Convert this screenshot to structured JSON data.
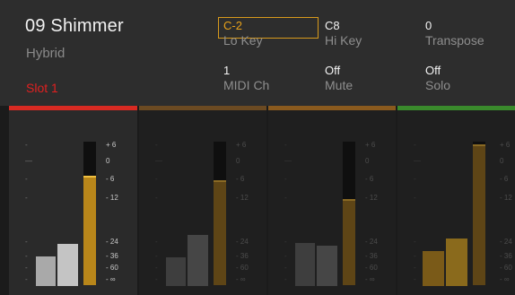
{
  "header": {
    "preset_name": "09 Shimmer",
    "preset_type": "Hybrid",
    "slot": "Slot 1",
    "params": [
      {
        "value": "C-2",
        "label": "Lo Key",
        "selected": true
      },
      {
        "value": "C8",
        "label": "Hi Key",
        "selected": false
      },
      {
        "value": "0",
        "label": "Transpose",
        "selected": false
      },
      {
        "value": "1",
        "label": "MIDI Ch",
        "selected": false
      },
      {
        "value": "Off",
        "label": "Mute",
        "selected": false
      },
      {
        "value": "Off",
        "label": "Solo",
        "selected": false
      }
    ]
  },
  "colors": {
    "header_bg": "#2d2d2d",
    "accent_orange": "#d89a1c",
    "slot_red": "#e02020",
    "strip1_bar": "#d82a22",
    "strip2_bar": "#6b4a22",
    "strip3_bar": "#8a5a1e",
    "strip4_bar": "#3a8a2c"
  },
  "meter_scale": {
    "left_marks": [
      "-",
      "—",
      "-",
      "-",
      "-",
      "-",
      "-",
      "-"
    ],
    "right_labels": [
      "+ 6",
      "0",
      "- 6",
      "- 12",
      "- 24",
      "- 36",
      "- 60",
      "- ∞"
    ]
  },
  "strips": [
    {
      "name": "slot-1",
      "active": true,
      "level": 0.76,
      "mini_levels": [
        0.3,
        0.43
      ]
    },
    {
      "name": "slot-2",
      "active": false,
      "level": 0.73,
      "mini_levels": [
        0.29,
        0.52
      ]
    },
    {
      "name": "slot-3",
      "active": false,
      "level": 0.6,
      "mini_levels": [
        0.44,
        0.41
      ]
    },
    {
      "name": "slot-4",
      "active": false,
      "level": 0.98,
      "mini_levels": [
        0.35,
        0.48
      ]
    }
  ]
}
